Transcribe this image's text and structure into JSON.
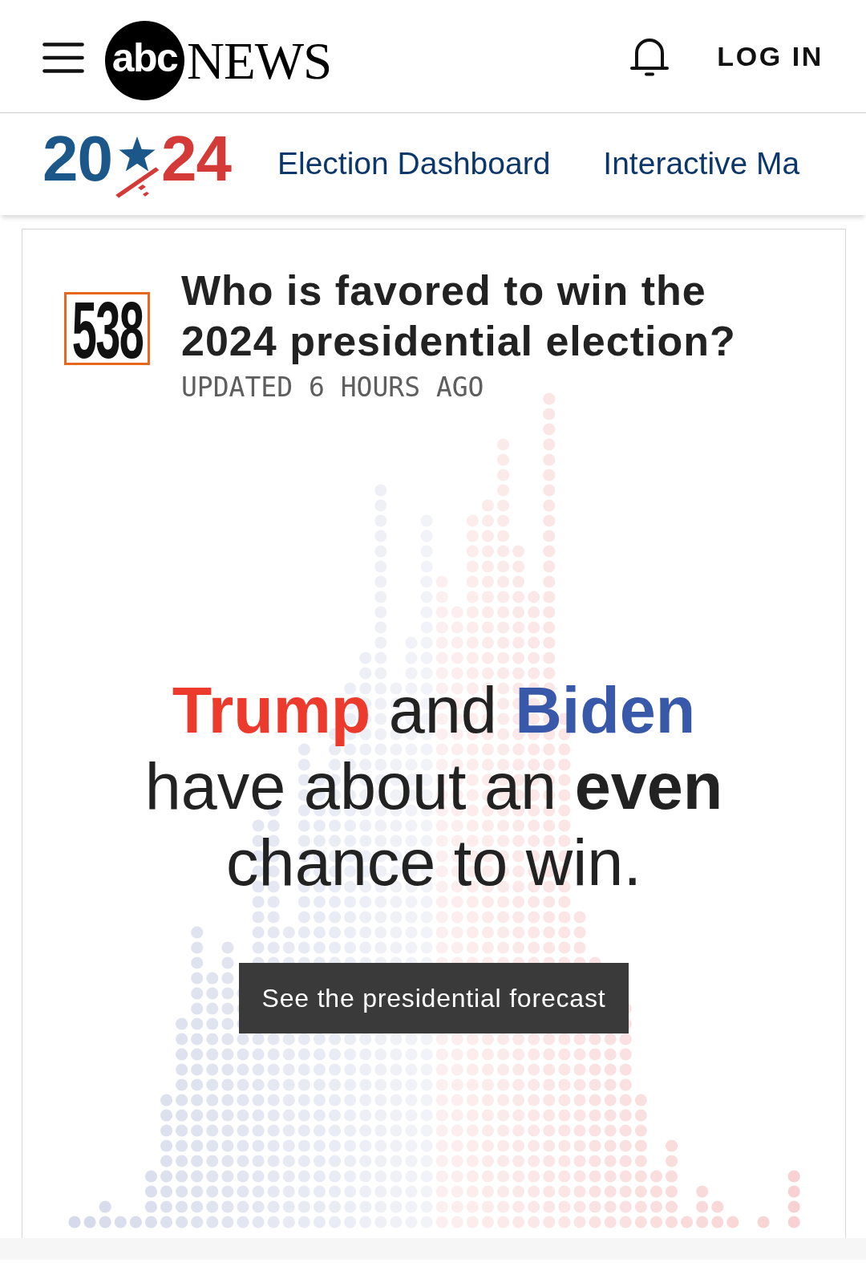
{
  "header": {
    "logo_badge": "abc",
    "logo_wordmark": "NEWS",
    "login": "LOG IN"
  },
  "election_nav": {
    "year_logo": [
      {
        "text": "20",
        "color": "#1b5789"
      },
      {
        "text": "24",
        "color": "#d43a37"
      }
    ],
    "links": [
      "Election Dashboard",
      "Interactive Ma"
    ]
  },
  "forecast_card": {
    "source_logo": "538",
    "title": "Who is favored to win the 2024 presidential election?",
    "updated": "UPDATED 6 HOURS AGO",
    "headline": [
      {
        "text": "**Trump**",
        "color": "#ec3a2d"
      },
      {
        "text": " and "
      },
      {
        "text": "**Biden**",
        "color": "#3858a9"
      },
      {
        "text": " have about an **even** chance to win."
      }
    ],
    "button": "See the presidential forecast"
  }
}
